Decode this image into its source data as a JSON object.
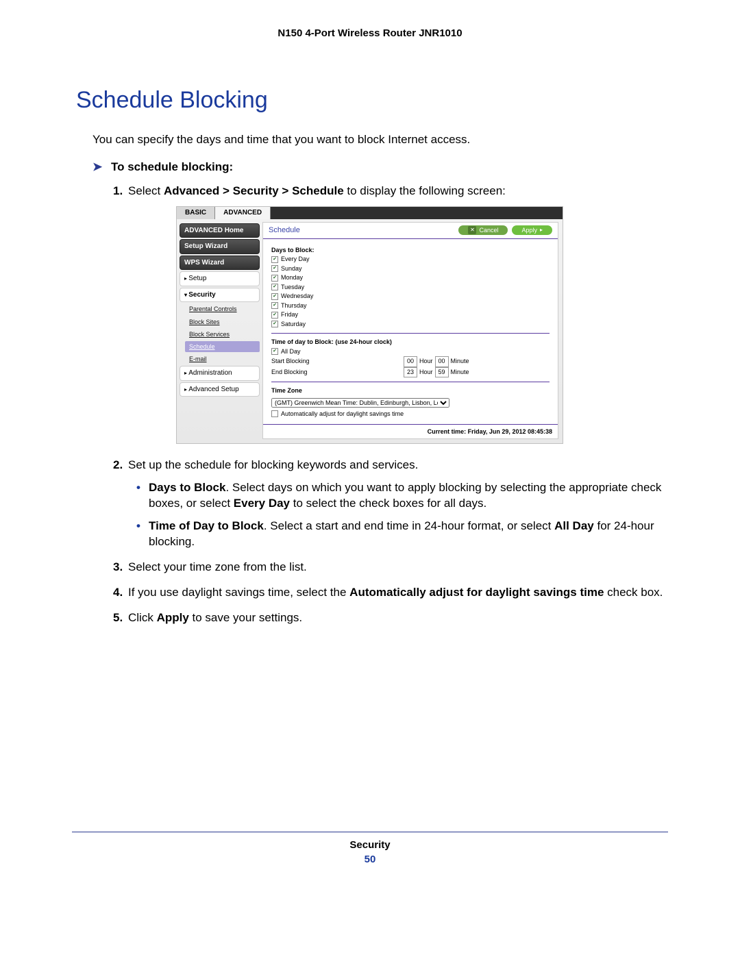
{
  "header": {
    "running": "N150 4-Port Wireless Router JNR1010"
  },
  "title": "Schedule Blocking",
  "intro": "You can specify the days and time that you want to block Internet access.",
  "proc": {
    "heading": "To schedule blocking:"
  },
  "step1": {
    "prefix": "Select ",
    "path": "Advanced > Security > Schedule",
    "suffix": " to display the following screen:"
  },
  "screenshot": {
    "tabs": {
      "basic": "BASIC",
      "advanced": "ADVANCED"
    },
    "sidebar": {
      "adv_home": "ADVANCED Home",
      "setup_wizard": "Setup Wizard",
      "wps_wizard": "WPS Wizard",
      "setup": "Setup",
      "security": "Security",
      "sec_children": {
        "parental": "Parental Controls",
        "block_sites": "Block Sites",
        "block_services": "Block Services",
        "schedule": "Schedule",
        "email": "E-mail"
      },
      "administration": "Administration",
      "advanced_setup": "Advanced Setup"
    },
    "content": {
      "title": "Schedule",
      "buttons": {
        "cancel": "Cancel",
        "apply": "Apply"
      },
      "days_label": "Days to Block:",
      "days": {
        "everyday": "Every Day",
        "sun": "Sunday",
        "mon": "Monday",
        "tue": "Tuesday",
        "wed": "Wednesday",
        "thu": "Thursday",
        "fri": "Friday",
        "sat": "Saturday"
      },
      "time_label": "Time of day to Block: (use 24-hour clock)",
      "all_day": "All Day",
      "start": {
        "label": "Start Blocking",
        "hour": "00",
        "hour_lab": "Hour",
        "min": "00",
        "min_lab": "Minute"
      },
      "end": {
        "label": "End Blocking",
        "hour": "23",
        "hour_lab": "Hour",
        "min": "59",
        "min_lab": "Minute"
      },
      "tz_label": "Time Zone",
      "tz_value": "(GMT) Greenwich Mean Time: Dublin, Edinburgh, Lisbon, London",
      "dst": "Automatically adjust for daylight savings time",
      "current_time": "Current time: Friday, Jun 29, 2012  08:45:38"
    }
  },
  "step2": {
    "text": "Set up the schedule for blocking keywords and services.",
    "bullet1_b": "Days to Block",
    "bullet1_rest": ". Select days on which you want to apply blocking by selecting the appropriate check boxes, or select ",
    "bullet1_b2": "Every Day",
    "bullet1_rest2": " to select the check boxes for all days.",
    "bullet2_b": "Time of Day to Block",
    "bullet2_rest": ". Select a start and end time in 24-hour format, or select ",
    "bullet2_b2": "All Day",
    "bullet2_rest2": " for 24-hour blocking."
  },
  "step3": "Select your time zone from the list.",
  "step4": {
    "prefix": "If you use daylight savings time, select the ",
    "bold": "Automatically adjust for daylight savings time",
    "suffix": " check box."
  },
  "step5": {
    "prefix": "Click ",
    "bold": "Apply",
    "suffix": " to save your settings."
  },
  "footer": {
    "section": "Security",
    "page": "50"
  }
}
